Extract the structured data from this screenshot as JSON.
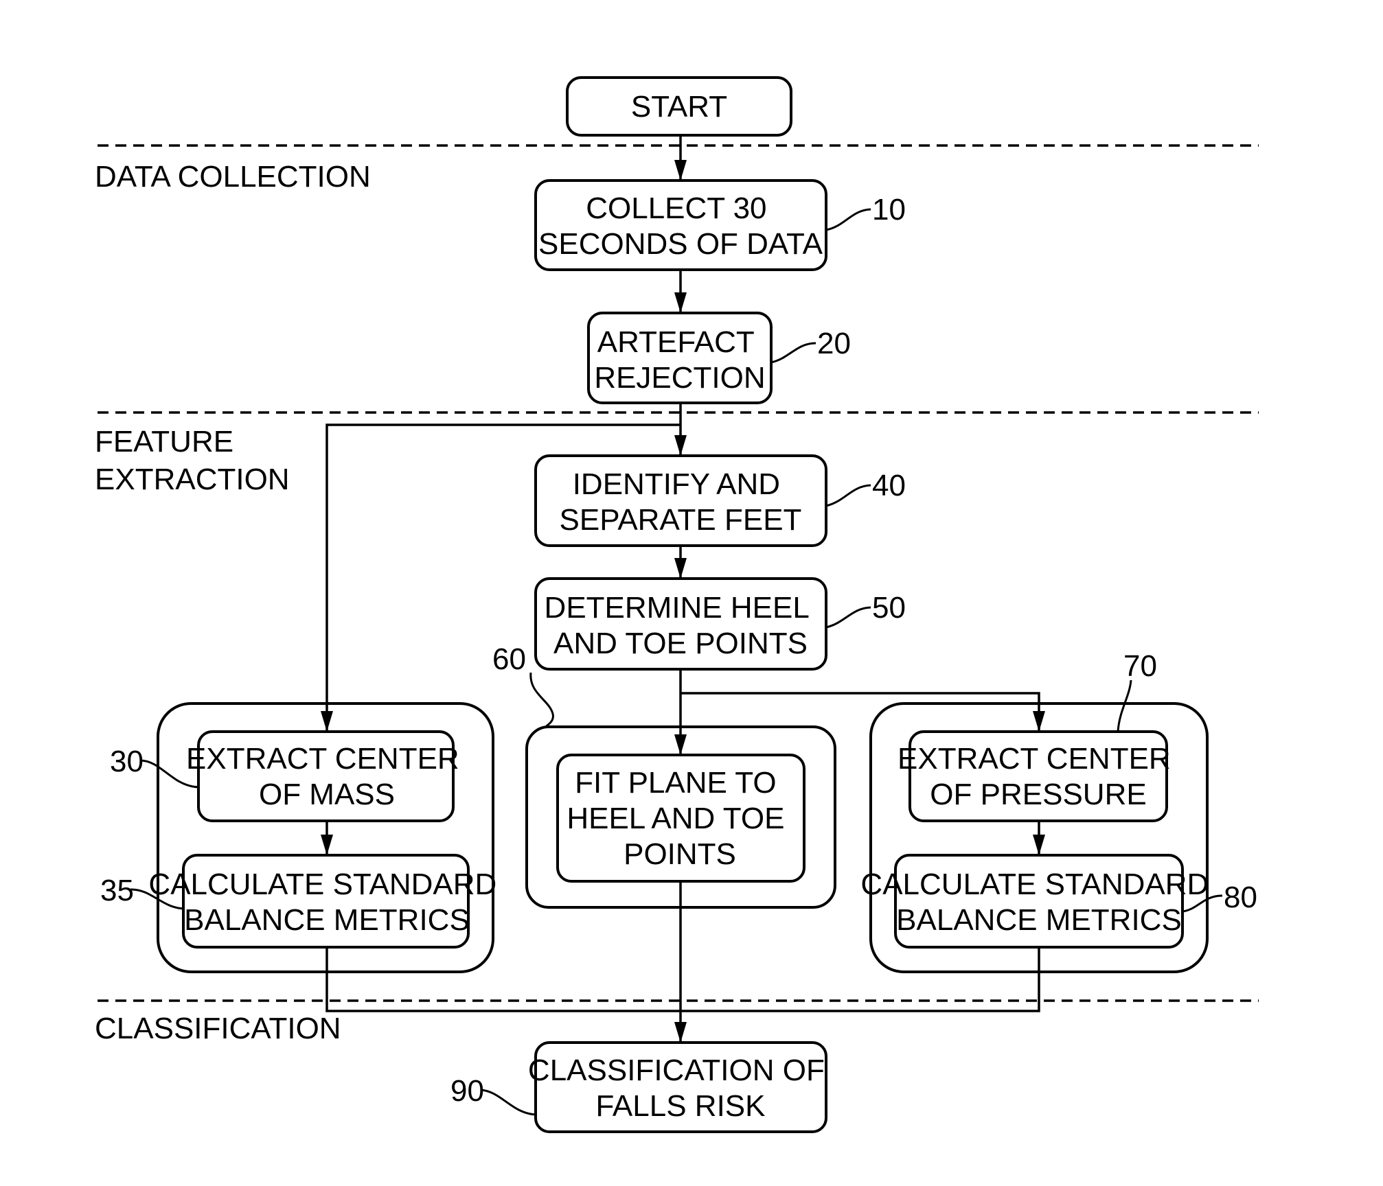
{
  "diagram": {
    "type": "flowchart",
    "sections": [
      {
        "id": "data-collection",
        "label": [
          "DATA COLLECTION"
        ]
      },
      {
        "id": "feature-extraction",
        "label": [
          "FEATURE",
          "EXTRACTION"
        ]
      },
      {
        "id": "classification",
        "label": [
          "CLASSIFICATION"
        ]
      }
    ],
    "nodes": {
      "start": {
        "lines": [
          "START"
        ],
        "ref": ""
      },
      "n10": {
        "lines": [
          "COLLECT 30",
          "SECONDS OF DATA"
        ],
        "ref": "10"
      },
      "n20": {
        "lines": [
          "ARTEFACT",
          "REJECTION"
        ],
        "ref": "20"
      },
      "n40": {
        "lines": [
          "IDENTIFY AND",
          "SEPARATE FEET"
        ],
        "ref": "40"
      },
      "n50": {
        "lines": [
          "DETERMINE HEEL",
          "AND TOE POINTS"
        ],
        "ref": "50"
      },
      "n30": {
        "lines": [
          "EXTRACT CENTER",
          "OF MASS"
        ],
        "ref": "30"
      },
      "n35": {
        "lines": [
          "CALCULATE STANDARD",
          "BALANCE METRICS"
        ],
        "ref": "35"
      },
      "n60": {
        "lines": [
          "FIT PLANE TO",
          "HEEL AND TOE",
          "POINTS"
        ],
        "ref": "60"
      },
      "n70": {
        "lines": [
          "EXTRACT CENTER",
          "OF PRESSURE"
        ],
        "ref": "70"
      },
      "n80": {
        "lines": [
          "CALCULATE STANDARD",
          "BALANCE METRICS"
        ],
        "ref": "80"
      },
      "n90": {
        "lines": [
          "CLASSIFICATION OF",
          "FALLS RISK"
        ],
        "ref": "90"
      }
    },
    "edges": [
      [
        "start",
        "n10"
      ],
      [
        "n10",
        "n20"
      ],
      [
        "n20",
        "n40"
      ],
      [
        "n20",
        "n30"
      ],
      [
        "n40",
        "n50"
      ],
      [
        "n50",
        "n60"
      ],
      [
        "n50",
        "n70"
      ],
      [
        "n30",
        "n35"
      ],
      [
        "n70",
        "n80"
      ],
      [
        "n35",
        "n90"
      ],
      [
        "n60",
        "n90"
      ],
      [
        "n80",
        "n90"
      ]
    ]
  }
}
